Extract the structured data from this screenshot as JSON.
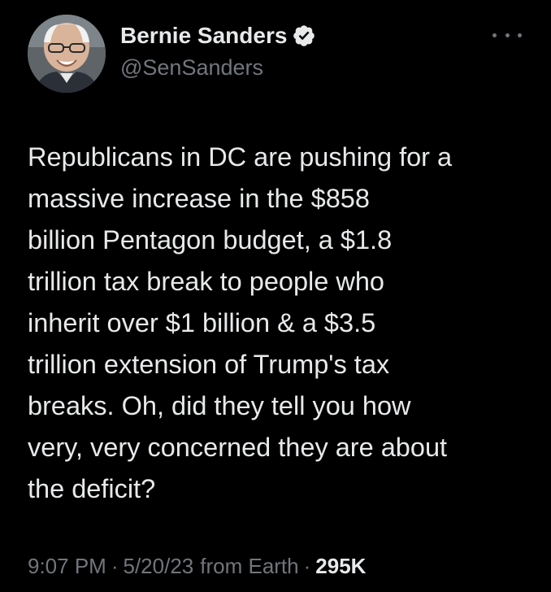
{
  "author": {
    "display_name": "Bernie Sanders",
    "handle": "@SenSanders",
    "verified": true,
    "verified_badge_color": "#e7e9ea"
  },
  "tweet": {
    "lines": [
      "Republicans in DC are pushing for a",
      "massive increase in the $858",
      "billion Pentagon budget, a $1.8",
      "trillion tax break to people who",
      "inherit over $1 billion & a $3.5",
      "trillion extension of Trump's tax",
      "breaks. Oh, did they tell you how",
      "very, very concerned they are about",
      "the deficit?"
    ]
  },
  "meta": {
    "time": "9:07 PM",
    "date": "5/20/23",
    "source": "from Earth",
    "separator": "·",
    "views": "295K"
  },
  "icons": {
    "more": "more-dots-icon",
    "verified": "verified-badge-icon"
  },
  "colors": {
    "background": "#000000",
    "text_primary": "#e7e9ea",
    "text_secondary": "#71767b"
  }
}
